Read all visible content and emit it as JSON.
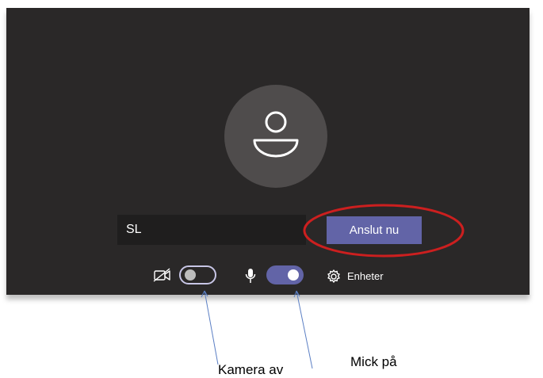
{
  "prejoin": {
    "name_value": "SL",
    "join_label": "Anslut nu",
    "devices_label": "Enheter",
    "camera_on": false,
    "mic_on": true
  },
  "annotations": {
    "camera_label": "Kamera av",
    "mic_label": "Mick på",
    "highlight_color": "#cc1f1f",
    "arrow_color": "#5b7fc4"
  },
  "colors": {
    "panel_bg": "#2a2828",
    "accent": "#6264a7"
  },
  "icons": [
    "avatar-person-icon",
    "camera-off-icon",
    "microphone-icon",
    "gear-icon"
  ]
}
